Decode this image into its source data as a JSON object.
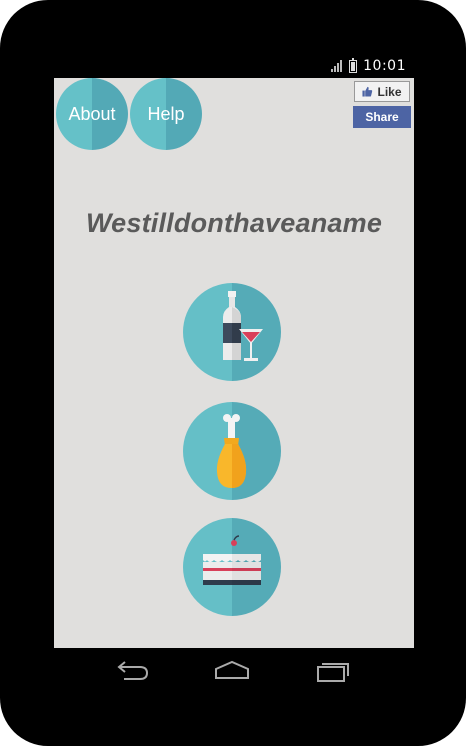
{
  "status_bar": {
    "time": "10:01",
    "signal_icon": "signal-icon",
    "battery_icon": "battery-icon"
  },
  "header": {
    "about_label": "About",
    "help_label": "Help"
  },
  "facebook": {
    "like_label": "Like",
    "share_label": "Share",
    "like_icon": "thumbs-up-icon"
  },
  "main": {
    "title": "Westilldonthaveaname",
    "categories": [
      {
        "icon": "drinks-icon"
      },
      {
        "icon": "chicken-leg-icon"
      },
      {
        "icon": "cake-icon"
      }
    ]
  },
  "nav_bar": {
    "back_icon": "back-icon",
    "home_icon": "home-icon",
    "recent_icon": "recent-apps-icon"
  },
  "colors": {
    "device_frame": "#000000",
    "screen_bg": "#e0dfdd",
    "circle_light": "#65c1c8",
    "circle_dark": "#53a9b6",
    "share_blue": "#4d64a4",
    "title_gray": "#5a5a5a"
  }
}
